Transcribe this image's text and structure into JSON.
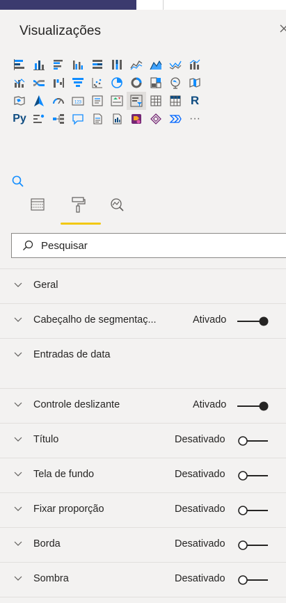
{
  "panel": {
    "title": "Visualizações",
    "close_icon": "close-icon"
  },
  "viz_icons": {
    "rows": [
      [
        "stacked-bar-icon",
        "stacked-column-icon",
        "clustered-bar-icon",
        "clustered-column-icon",
        "100-bar-icon",
        "100-column-icon",
        "line-chart-icon",
        "area-chart-icon",
        "stacked-area-icon",
        "line-column-icon"
      ],
      [
        "line-clustered-column-icon",
        "ribbon-chart-icon",
        "waterfall-icon",
        "funnel-icon",
        "scatter-icon",
        "pie-chart-icon",
        "donut-chart-icon",
        "treemap-icon",
        "map-icon",
        "filled-map-icon"
      ],
      [
        "shape-map-icon",
        "azure-map-icon",
        "gauge-icon",
        "card-icon",
        "multi-row-card-icon",
        "kpi-icon",
        "slicer-icon",
        "table-icon",
        "matrix-icon",
        "r-visual-icon"
      ],
      [
        "python-visual-icon",
        "key-influencers-icon",
        "decomposition-tree-icon",
        "qna-icon",
        "smart-narrative-icon",
        "paginated-report-icon",
        "power-apps-icon",
        "diamond-visual-icon",
        "power-automate-icon",
        "more-icon"
      ]
    ],
    "r_label": "R",
    "py_label": "Py",
    "more_label": "···"
  },
  "tabs": [
    "fields-tab-icon",
    "format-tab-icon",
    "analytics-tab-icon"
  ],
  "search": {
    "placeholder": "Pesquisar"
  },
  "sections": [
    {
      "label": "Geral",
      "state": "",
      "toggle": null
    },
    {
      "label": "Cabeçalho de segmentaç...",
      "state": "Ativado",
      "toggle": "on"
    },
    {
      "label": "Entradas de data",
      "state": "",
      "toggle": null
    },
    {
      "label": "Controle deslizante",
      "state": "Ativado",
      "toggle": "on"
    },
    {
      "label": "Título",
      "state": "Desativado",
      "toggle": "off"
    },
    {
      "label": "Tela de fundo",
      "state": "Desativado",
      "toggle": "off"
    },
    {
      "label": "Fixar proporção",
      "state": "Desativado",
      "toggle": "off"
    },
    {
      "label": "Borda",
      "state": "Desativado",
      "toggle": "off"
    },
    {
      "label": "Sombra",
      "state": "Desativado",
      "toggle": "off"
    }
  ],
  "colors": {
    "accent": "#f2c811",
    "icon": "#605e5c",
    "blue": "#118dff",
    "text": "#252423",
    "panel": "#f3f2f1",
    "header_dark": "#3b3a6e"
  }
}
